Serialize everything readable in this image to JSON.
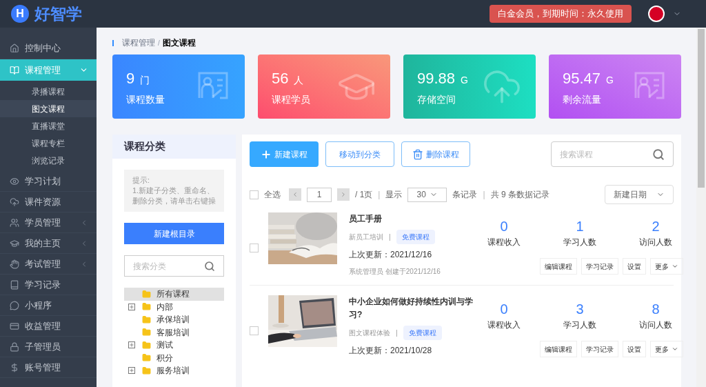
{
  "header": {
    "logo_letter": "H",
    "logo_text": "好智学",
    "membership": "白金会员，到期时间：永久使用"
  },
  "sidebar": {
    "items": [
      {
        "label": "控制中心",
        "selected": false
      },
      {
        "label": "课程管理",
        "selected": true,
        "expanded": true,
        "children": [
          {
            "label": "录播课程",
            "selected": false
          },
          {
            "label": "图文课程",
            "selected": true
          },
          {
            "label": "直播课堂",
            "selected": false
          },
          {
            "label": "课程专栏",
            "selected": false
          },
          {
            "label": "浏览记录",
            "selected": false
          }
        ]
      },
      {
        "label": "学习计划",
        "selected": false
      },
      {
        "label": "课件资源",
        "selected": false
      },
      {
        "label": "学员管理",
        "selected": false,
        "expanded": false
      },
      {
        "label": "我的主页",
        "selected": false,
        "expanded": false
      },
      {
        "label": "考试管理",
        "selected": false,
        "expanded": false
      },
      {
        "label": "学习记录",
        "selected": false
      },
      {
        "label": "小程序",
        "selected": false
      },
      {
        "label": "收益管理",
        "selected": false
      },
      {
        "label": "子管理员",
        "selected": false
      },
      {
        "label": "账号管理",
        "selected": false
      }
    ]
  },
  "breadcrumb": [
    "课程管理",
    "图文课程"
  ],
  "breadcrumb_separator": "/",
  "separator": "|",
  "stats": [
    {
      "kind": "courses",
      "value": "9",
      "unit": "门",
      "label": "课程数量"
    },
    {
      "kind": "students",
      "value": "56",
      "unit": "人",
      "label": "课程学员"
    },
    {
      "kind": "storage",
      "value": "99.88",
      "unit": "G",
      "label": "存储空间"
    },
    {
      "kind": "traffic",
      "value": "95.47",
      "unit": "G",
      "label": "剩余流量"
    }
  ],
  "category_panel": {
    "title": "课程分类",
    "hint_title": "提示:",
    "hint_text": "1.新建子分类、重命名、删除分类，请单击右键操",
    "new_root_button": "新建根目录",
    "search_placeholder": "搜索分类",
    "tree": [
      {
        "label": "所有课程",
        "selected": true
      },
      {
        "label": "内部",
        "selected": false,
        "expanded": false
      },
      {
        "label": "承保培训",
        "selected": false
      },
      {
        "label": "客服培训",
        "selected": false
      },
      {
        "label": "测试",
        "selected": false,
        "expanded": false
      },
      {
        "label": "积分",
        "selected": false
      },
      {
        "label": "服务培训",
        "selected": false,
        "expanded": false
      }
    ]
  },
  "toolbar": {
    "buttons": [
      {
        "kind": "primary",
        "label": "新建课程"
      },
      {
        "kind": "outline",
        "label": "移动到分类"
      },
      {
        "kind": "delete",
        "label": "删除课程"
      }
    ],
    "search_placeholder": "搜索课程"
  },
  "pager": {
    "select_all": "全选",
    "checked": false,
    "page": "1",
    "pages": "/ 1页",
    "show": "显示",
    "page_size": "30",
    "records": "条记录",
    "total": "共 9 条数据记录",
    "sort": "新建日期"
  },
  "courses": [
    {
      "checked": false,
      "title": "员工手册",
      "category": "新员工培训",
      "tag": "免费课程",
      "updated": "上次更新：2021/12/16",
      "creator": "系统管理员 创建于2021/12/16",
      "stats": [
        {
          "value": "0",
          "label": "课程收入"
        },
        {
          "value": "1",
          "label": "学习人数"
        },
        {
          "value": "2",
          "label": "访问人数"
        }
      ],
      "actions": [
        "编辑课程",
        "学习记录",
        "设置",
        "更多"
      ]
    },
    {
      "checked": false,
      "title": "中小企业如何做好持续性内训与学习?",
      "category": "图文课程体验",
      "tag": "免费课程",
      "updated": "上次更新：2021/10/28",
      "stats": [
        {
          "value": "0",
          "label": "课程收入"
        },
        {
          "value": "3",
          "label": "学习人数"
        },
        {
          "value": "8",
          "label": "访问人数"
        }
      ],
      "actions": [
        "编辑课程",
        "学习记录",
        "设置",
        "更多"
      ]
    }
  ]
}
